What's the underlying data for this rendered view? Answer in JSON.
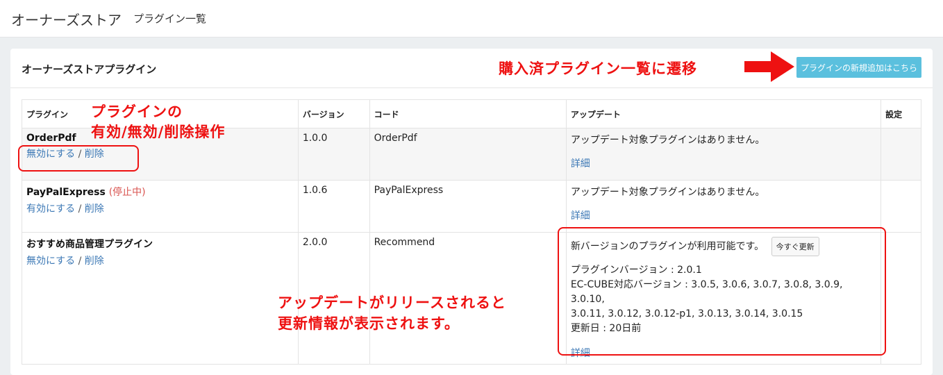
{
  "header": {
    "title": "オーナーズストア",
    "subtitle": "プラグイン一覧"
  },
  "panel": {
    "title": "オーナーズストアプラグイン",
    "new_button_label": "プラグインの新規追加はこちら"
  },
  "table": {
    "headers": [
      "プラグイン",
      "バージョン",
      "コード",
      "アップデート",
      "設定"
    ],
    "rows": [
      {
        "name": "OrderPdf",
        "status": "",
        "actions": {
          "primary": "無効にする",
          "separator": "/",
          "delete": "削除"
        },
        "version": "1.0.0",
        "code": "OrderPdf",
        "update_text": "アップデート対象プラグインはありません。",
        "detail": "詳細"
      },
      {
        "name": "PayPalExpress",
        "status": "(停止中)",
        "actions": {
          "primary": "有効にする",
          "separator": "/",
          "delete": "削除"
        },
        "version": "1.0.6",
        "code": "PayPalExpress",
        "update_text": "アップデート対象プラグインはありません。",
        "detail": "詳細"
      },
      {
        "name": "おすすめ商品管理プラグイン",
        "status": "",
        "actions": {
          "primary": "無効にする",
          "separator": "/",
          "delete": "削除"
        },
        "version": "2.0.0",
        "code": "Recommend",
        "update_text": "新バージョンのプラグインが利用可能です。",
        "update_button": "今すぐ更新",
        "info": [
          "プラグインバージョン : 2.0.1",
          "EC-CUBE対応バージョン : 3.0.5, 3.0.6, 3.0.7, 3.0.8, 3.0.9, 3.0.10,",
          "3.0.11, 3.0.12, 3.0.12-p1, 3.0.13, 3.0.14, 3.0.15",
          "更新日 : 20日前"
        ],
        "detail": "詳細"
      }
    ]
  },
  "annotations": {
    "purchased": "購入済プラグイン一覧に遷移",
    "ops_line1": "プラグインの",
    "ops_line2": "有効/無効/削除操作",
    "release_line1": "アップデートがリリースされると",
    "release_line2": "更新情報が表示されます。",
    "color": "#ee1111"
  },
  "colors": {
    "accent_button": "#5bc0de",
    "link": "#3c78b5",
    "stopped": "#d9534f"
  }
}
